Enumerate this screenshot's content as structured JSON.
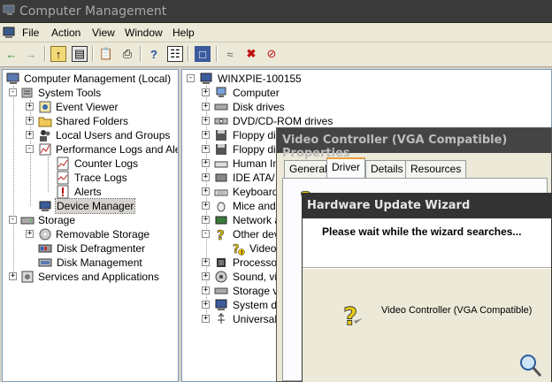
{
  "window": {
    "title": "Computer Management"
  },
  "menu": [
    "File",
    "Action",
    "View",
    "Window",
    "Help"
  ],
  "toolbar_icons": [
    "back-icon",
    "forward-icon",
    "up-icon",
    "show-hide-tree-icon",
    "properties-icon",
    "print-icon",
    "help-icon",
    "details-icon",
    "device-icon",
    "network-icon",
    "uninstall-icon",
    "disable-icon"
  ],
  "left_tree": {
    "root": "Computer Management (Local)",
    "system_tools": "System Tools",
    "event_viewer": "Event Viewer",
    "shared_folders": "Shared Folders",
    "local_users": "Local Users and Groups",
    "perf_logs": "Performance Logs and Alerts",
    "counter_logs": "Counter Logs",
    "trace_logs": "Trace Logs",
    "alerts": "Alerts",
    "device_manager": "Device Manager",
    "storage": "Storage",
    "removable_storage": "Removable Storage",
    "disk_defrag": "Disk Defragmenter",
    "disk_mgmt": "Disk Management",
    "services_apps": "Services and Applications"
  },
  "right_tree": {
    "root": "WINXPIE-100155",
    "items": [
      "Computer",
      "Disk drives",
      "DVD/CD-ROM drives",
      "Floppy dis",
      "Floppy dis",
      "Human In",
      "IDE ATA/",
      "Keyboard",
      "Mice and",
      "Network a",
      "Other dev",
      "Video",
      "Processor",
      "Sound, vi",
      "Storage v",
      "System de",
      "Universal"
    ]
  },
  "properties_dialog": {
    "title": "Video Controller (VGA Compatible) Properties",
    "tabs": [
      "General",
      "Driver",
      "Details",
      "Resources"
    ],
    "active_tab": "Driver"
  },
  "wizard": {
    "title": "Hardware Update Wizard",
    "status": "Please wait while the wizard searches...",
    "device": "Video Controller (VGA Compatible)"
  }
}
